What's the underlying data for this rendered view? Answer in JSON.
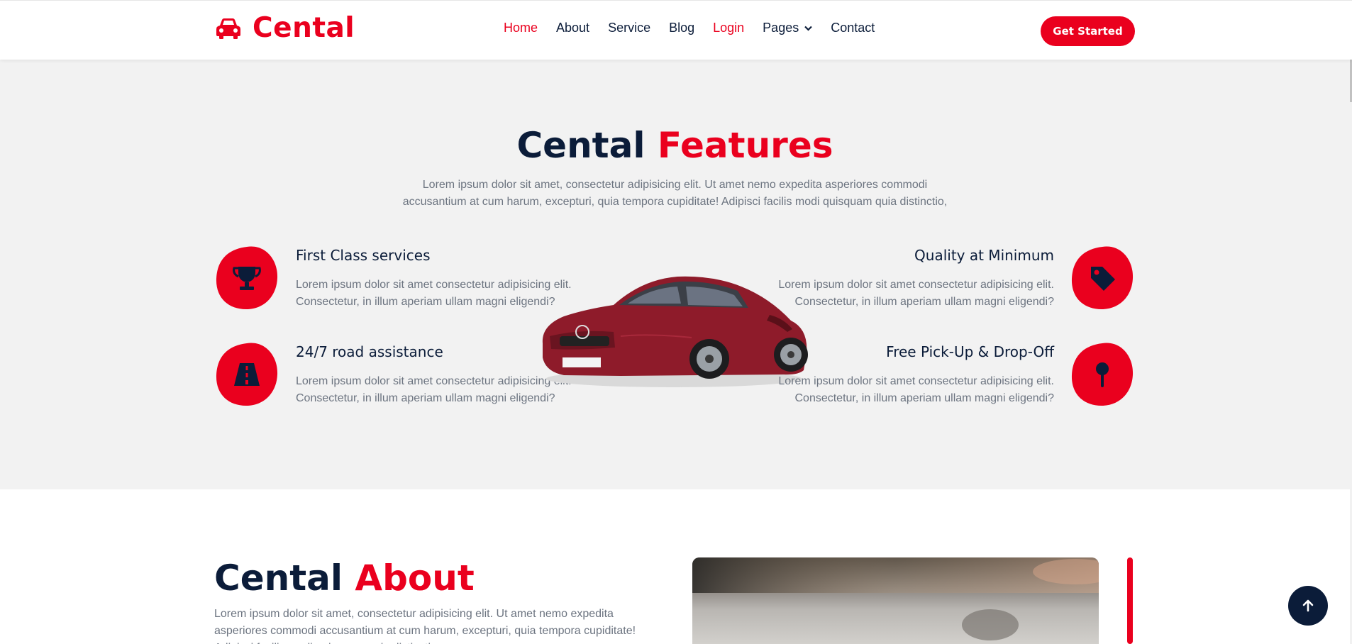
{
  "brand": {
    "name": "Cental",
    "icon": "car-icon"
  },
  "nav": {
    "items": [
      {
        "label": "Home",
        "state": "active"
      },
      {
        "label": "About",
        "state": ""
      },
      {
        "label": "Service",
        "state": ""
      },
      {
        "label": "Blog",
        "state": ""
      },
      {
        "label": "Login",
        "state": "highlight"
      },
      {
        "label": "Pages",
        "state": "dropdown"
      },
      {
        "label": "Contact",
        "state": ""
      }
    ],
    "cta_label": "Get Started"
  },
  "features": {
    "title_main": "Cental",
    "title_accent": "Features",
    "description": "Lorem ipsum dolor sit amet, consectetur adipisicing elit. Ut amet nemo expedita asperiores commodi accusantium at cum harum, excepturi, quia tempora cupiditate! Adipisci facilis modi quisquam quia distinctio,",
    "items": [
      {
        "title": "First Class services",
        "text": "Lorem ipsum dolor sit amet consectetur adipisicing elit. Consectetur, in illum aperiam ullam magni eligendi?",
        "icon": "trophy-icon"
      },
      {
        "title": "24/7 road assistance",
        "text": "Lorem ipsum dolor sit amet consectetur adipisicing elit. Consectetur, in illum aperiam ullam magni eligendi?",
        "icon": "road-icon"
      },
      {
        "title": "Quality at Minimum",
        "text": "Lorem ipsum dolor sit amet consectetur adipisicing elit. Consectetur, in illum aperiam ullam magni eligendi?",
        "icon": "tag-icon"
      },
      {
        "title": "Free Pick-Up & Drop-Off",
        "text": "Lorem ipsum dolor sit amet consectetur adipisicing elit. Consectetur, in illum aperiam ullam magni eligendi?",
        "icon": "map-pin-icon"
      }
    ]
  },
  "about": {
    "title_main": "Cental",
    "title_accent": "About",
    "description": "Lorem ipsum dolor sit amet, consectetur adipisicing elit. Ut amet nemo expedita asperiores commodi accusantium at cum harum, excepturi, quia tempora cupiditate! Adipisci facilis modi quisquam quia distinctio,"
  },
  "colors": {
    "accent": "#ea001e",
    "dark": "#0b1c39",
    "muted": "#6c7480",
    "section_bg": "#f2f2f2"
  },
  "back_to_top_icon": "arrow-up-icon"
}
